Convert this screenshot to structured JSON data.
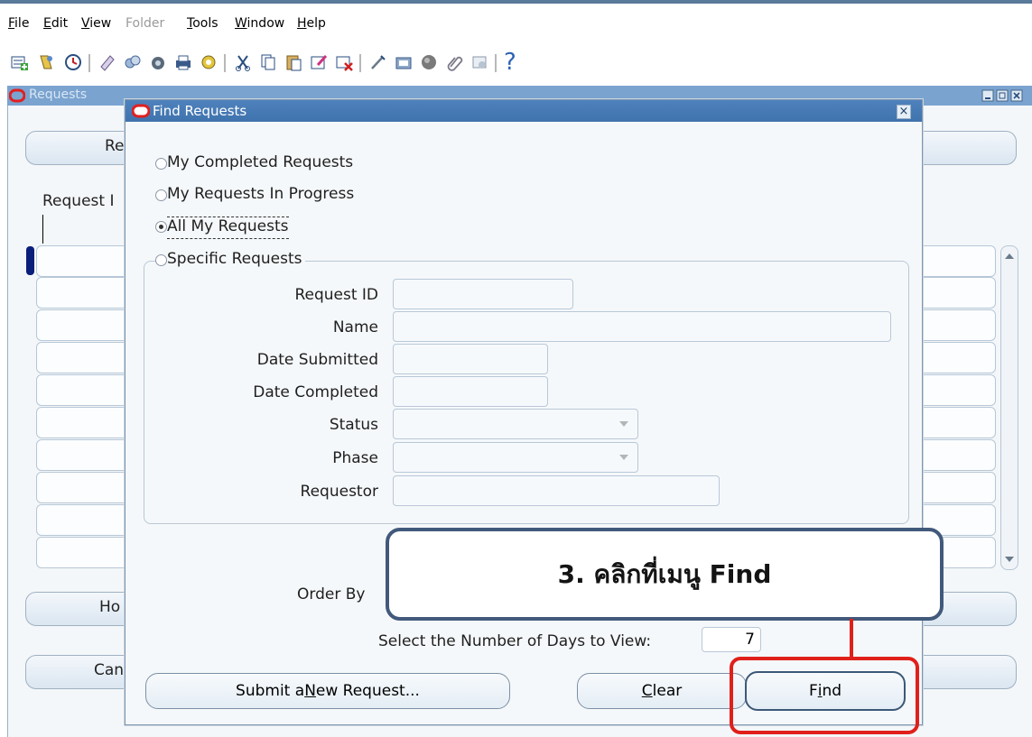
{
  "menubar": {
    "items": [
      {
        "label": "File",
        "accel": "F",
        "rest": "ile",
        "enabled": true
      },
      {
        "label": "Edit",
        "accel": "E",
        "rest": "dit",
        "enabled": true
      },
      {
        "label": "View",
        "accel": "V",
        "rest": "iew",
        "enabled": true
      },
      {
        "label": "Folder",
        "enabled": false
      },
      {
        "label": "Tools",
        "accel": "T",
        "rest": "ools",
        "enabled": true
      },
      {
        "label": "Window",
        "accel": "W",
        "rest": "indow",
        "enabled": true
      },
      {
        "label": "Help",
        "accel": "H",
        "rest": "elp",
        "enabled": true
      }
    ]
  },
  "toolbar": {
    "help_glyph": "?",
    "icons": [
      "new-record-icon",
      "navigate-icon",
      "zoom-icon",
      "save-icon",
      "switch-responsibility-icon",
      "translate-icon",
      "print-icon",
      "refresh-icon",
      "cut-icon",
      "copy-icon",
      "paste-icon",
      "edit-field-icon",
      "clear-record-icon",
      "attachments-icon",
      "folder-tools-icon",
      "globe-icon",
      "paperclip-icon",
      "customize-icon",
      "help-icon"
    ]
  },
  "background_window": {
    "title": "Requests",
    "tab_fragment": "Re",
    "column_fragment": "Request I",
    "button_fragment_hold": "Ho",
    "button_fragment_cancel": "Can"
  },
  "dialog": {
    "title": "Find Requests",
    "close_glyph": "×",
    "options": [
      {
        "label": "My Completed Requests",
        "selected": false
      },
      {
        "label": "My Requests In Progress",
        "selected": false
      },
      {
        "label": "All My Requests",
        "selected": true
      },
      {
        "label": "Specific Requests",
        "selected": false
      }
    ],
    "fields": {
      "request_id_label": "Request ID",
      "name_label": "Name",
      "date_submitted_label": "Date Submitted",
      "date_completed_label": "Date Completed",
      "status_label": "Status",
      "phase_label": "Phase",
      "requestor_label": "Requestor"
    },
    "order_by_label": "Order By",
    "days_label": "Select the Number of Days to View:",
    "days_value": "7",
    "buttons": {
      "submit_pre": "Submit a ",
      "submit_accel": "N",
      "submit_post": "ew Request...",
      "clear_accel": "C",
      "clear_rest": "lear",
      "find_pre": "F",
      "find_accel": "i",
      "find_post": "nd"
    }
  },
  "callout": {
    "text": "3. คลิกที่เมนู Find",
    "highlight_color": "#e0201b",
    "border_color": "#41597b"
  }
}
